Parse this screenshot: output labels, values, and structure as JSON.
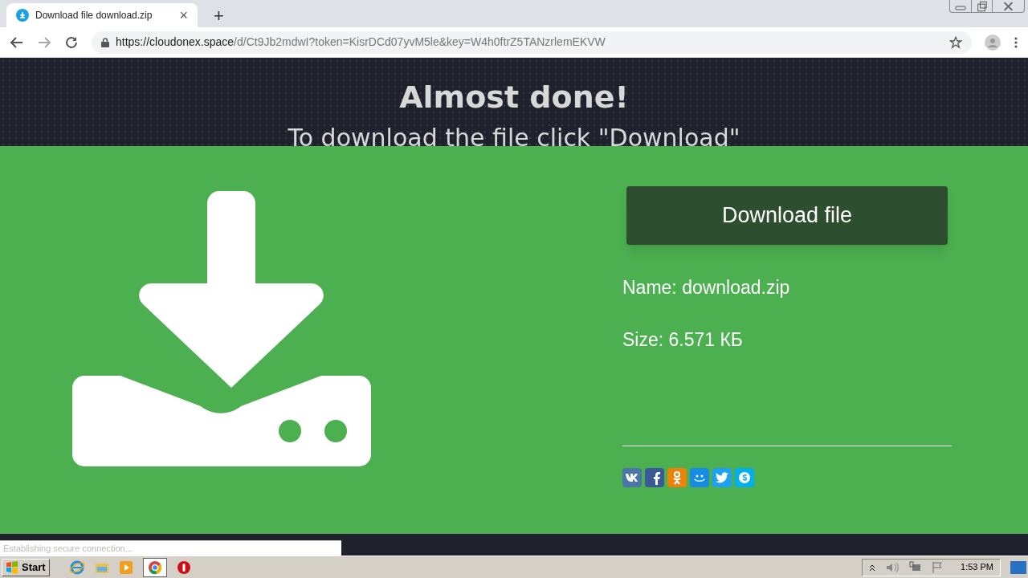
{
  "browser": {
    "tab_title": "Download file download.zip",
    "tab_close": "×",
    "new_tab": "+",
    "url_host": "https://cloudonex.space",
    "url_path": "/d/Ct9Jb2mdwI?token=KisrDCd07yvM5le&key=W4h0ftrZ5TANzrlemEKVW"
  },
  "header": {
    "title": "Almost done!",
    "subtitle": "To download the file click \"Download\""
  },
  "download": {
    "button": "Download file",
    "name": "Name: download.zip",
    "size": "Size: 6.571 КБ"
  },
  "share": [
    {
      "kind": "vk",
      "color": "#4a76a8"
    },
    {
      "kind": "fb",
      "color": "#3b5998"
    },
    {
      "kind": "ok",
      "color": "#ee8208"
    },
    {
      "kind": "mr",
      "color": "#168de2"
    },
    {
      "kind": "tw",
      "color": "#1da1f2"
    },
    {
      "kind": "sk",
      "color": "#00aff0"
    }
  ],
  "status": "Establishing secure connection...",
  "taskbar": {
    "start": "Start",
    "clock": "1:53 PM"
  }
}
